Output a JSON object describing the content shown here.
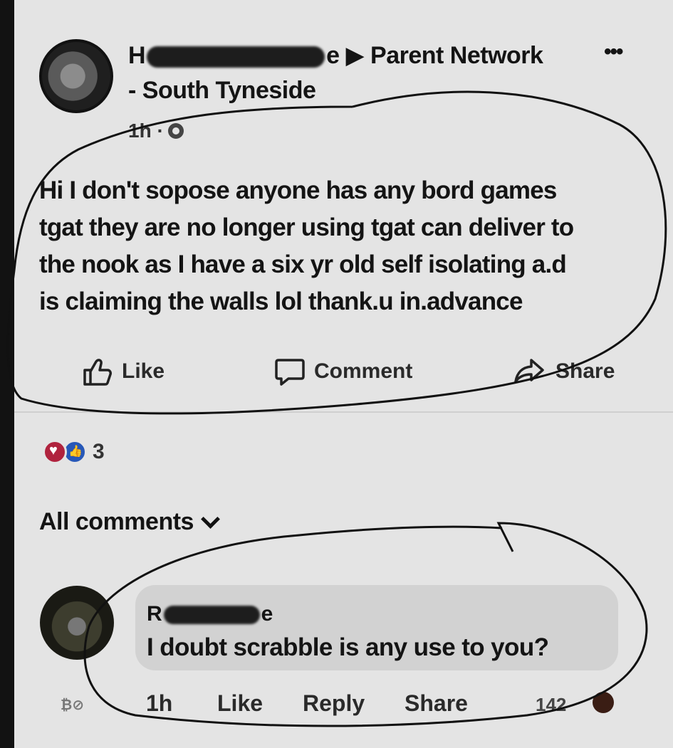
{
  "post": {
    "author_start": "H",
    "author_end": "e",
    "group": "Parent Network",
    "group_sub": "- South Tyneside",
    "time": "1h ·",
    "more": "•••",
    "lines": [
      "Hi I don't sopose anyone has any bord games",
      "tgat they are no longer using tgat can deliver to",
      "the nook as I have a six yr old self isolating a.d",
      "is claiming the walls lol  thank.u in.advance"
    ]
  },
  "actions": {
    "like": "Like",
    "comment": "Comment",
    "share": "Share"
  },
  "reactions": {
    "count": "3"
  },
  "comments_header": "All comments",
  "comment": {
    "name_start": "R",
    "name_end": "e",
    "text": "I doubt scrabble is any use to you?",
    "time": "1h",
    "like": "Like",
    "reply": "Reply",
    "share": "Share",
    "count": "142"
  },
  "colors": {
    "background": "#e4e4e4",
    "text": "#141414",
    "ink": "#111111",
    "heart": "#b0233e",
    "like": "#2758b8"
  },
  "icons": [
    "thumbs-up-icon",
    "comment-bubble-icon",
    "share-arrow-icon",
    "globe-icon",
    "chevron-down-icon"
  ]
}
